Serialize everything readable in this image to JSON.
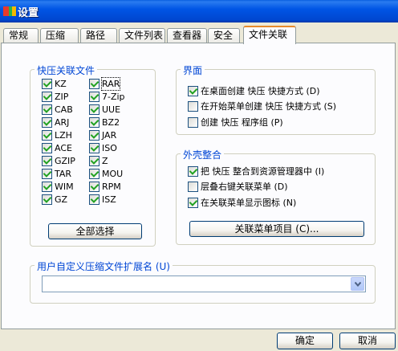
{
  "window": {
    "title": "设置"
  },
  "tabs": [
    {
      "label": "常规",
      "active": false
    },
    {
      "label": "压缩",
      "active": false
    },
    {
      "label": "路径",
      "active": false
    },
    {
      "label": "文件列表",
      "active": false
    },
    {
      "label": "查看器",
      "active": false
    },
    {
      "label": "安全",
      "active": false
    },
    {
      "label": "文件关联",
      "active": true
    }
  ],
  "associations": {
    "title": "快压关联文件",
    "left": [
      {
        "label": "KZ",
        "checked": true
      },
      {
        "label": "ZIP",
        "checked": true
      },
      {
        "label": "CAB",
        "checked": true
      },
      {
        "label": "ARJ",
        "checked": true
      },
      {
        "label": "LZH",
        "checked": true
      },
      {
        "label": "ACE",
        "checked": true
      },
      {
        "label": "GZIP",
        "checked": true
      },
      {
        "label": "TAR",
        "checked": true
      },
      {
        "label": "WIM",
        "checked": true
      },
      {
        "label": "GZ",
        "checked": true
      }
    ],
    "right": [
      {
        "label": "RAR",
        "checked": true,
        "focused": true
      },
      {
        "label": "7-Zip",
        "checked": true
      },
      {
        "label": "UUE",
        "checked": true
      },
      {
        "label": "BZ2",
        "checked": true
      },
      {
        "label": "JAR",
        "checked": true
      },
      {
        "label": "ISO",
        "checked": true
      },
      {
        "label": "Z",
        "checked": true
      },
      {
        "label": "MOU",
        "checked": true
      },
      {
        "label": "RPM",
        "checked": true
      },
      {
        "label": "ISZ",
        "checked": true
      }
    ],
    "select_all_label": "全部选择"
  },
  "interface": {
    "title": "界面",
    "options": [
      {
        "label": "在桌面创建 快压 快捷方式 (D)",
        "checked": true
      },
      {
        "label": "在开始菜单创建 快压 快捷方式 (S)",
        "checked": false
      },
      {
        "label": "创建 快压 程序组 (P)",
        "checked": false
      }
    ]
  },
  "shell": {
    "title": "外壳整合",
    "options": [
      {
        "label": "把 快压 整合到资源管理器中 (I)",
        "checked": true
      },
      {
        "label": "层叠右键关联菜单 (D)",
        "checked": false
      },
      {
        "label": "在关联菜单显示图标 (N)",
        "checked": true
      }
    ],
    "menu_items_label": "关联菜单项目 (C)..."
  },
  "custom_ext": {
    "title": "用户自定义压缩文件扩展名 (U)",
    "value": ""
  },
  "footer": {
    "ok_label": "确定",
    "cancel_label": "取消"
  },
  "colors": {
    "titlebar": "#0055e5",
    "group_title": "#0046d5",
    "active_tab_accent": "#e68b2c"
  }
}
